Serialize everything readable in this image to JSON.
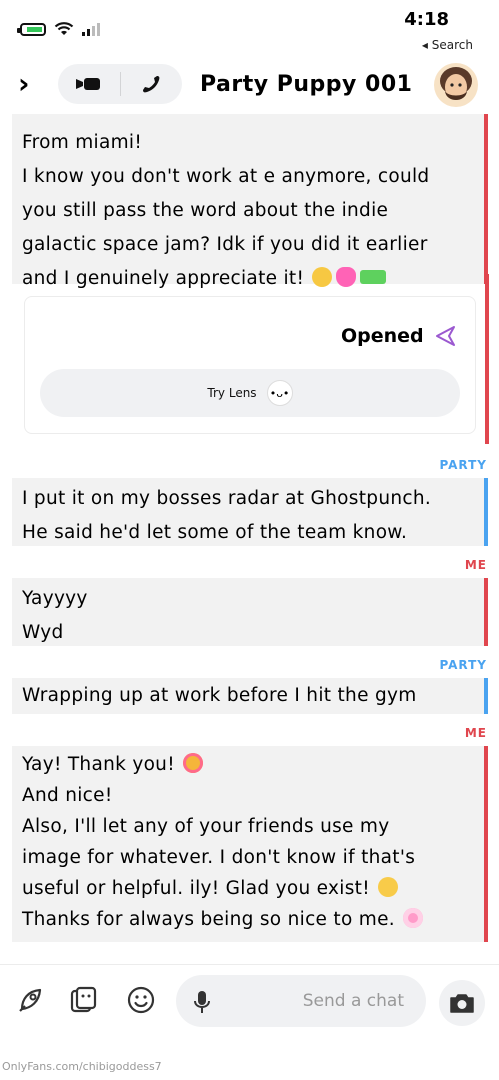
{
  "status_bar": {
    "time": "4:18",
    "back_label": "◂ Search",
    "battery_level": 0.6
  },
  "header": {
    "contact_name": "Party Puppy 001",
    "back_icon": "chevron-right-icon",
    "call_icon": "phone-icon",
    "video_icon": "video-camera-icon",
    "avatar_icon": "bitmoji-avatar"
  },
  "chat": {
    "first_message": {
      "lines": [
        "From miami!",
        "I know you don't work at e anymore, could",
        "you still pass the word about the indie",
        "galactic space jam? Idk if you did it earlier",
        "and I genuinely appreciate it!"
      ],
      "trailing_emoji": [
        "pleading-face",
        "growing-heart",
        "water-pistol"
      ]
    },
    "opened_card": {
      "status": "Opened",
      "status_icon": "sent-arrow-icon",
      "lens_button": "Try Lens"
    },
    "messages": [
      {
        "sender": "PARTY",
        "lines": [
          "I put it on my bosses radar at Ghostpunch.",
          "He said he'd let some of the team know."
        ]
      },
      {
        "sender": "ME",
        "lines": [
          "Yayyyy",
          "Wyd"
        ]
      },
      {
        "sender": "PARTY",
        "lines": [
          "Wrapping up at work before I hit the gym"
        ]
      },
      {
        "sender": "ME",
        "lines": [
          "Yay! Thank you!",
          "And nice!",
          "Also, I'll let any of your friends use my",
          "image for whatever. I don't know if that's",
          "useful or helpful. ily! Glad you exist!",
          "Thanks for always being so nice to me."
        ]
      }
    ]
  },
  "input_bar": {
    "placeholder": "Send a chat",
    "icons": [
      "rocket-icon",
      "sticker-icon",
      "smiley-icon",
      "mic-icon",
      "camera-icon"
    ]
  },
  "watermark": "OnlyFans.com/chibigoddess7",
  "colors": {
    "me_accent": "#e0464e",
    "party_accent": "#4aa3f0",
    "bubble_bg": "#f2f2f2",
    "pill_bg": "#f0f1f3"
  }
}
